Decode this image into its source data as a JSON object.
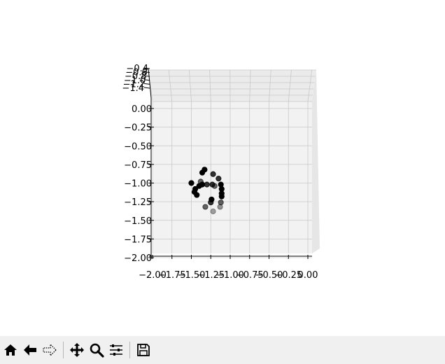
{
  "toolbar": {
    "buttons": [
      {
        "name": "home-button",
        "icon": "home-icon"
      },
      {
        "name": "back-button",
        "icon": "arrow-left-icon"
      },
      {
        "name": "forward-button",
        "icon": "arrow-right-icon"
      },
      {
        "name": "pan-button",
        "icon": "move-icon"
      },
      {
        "name": "zoom-button",
        "icon": "magnifier-icon"
      },
      {
        "name": "configure-subplots-button",
        "icon": "sliders-icon"
      },
      {
        "name": "save-button",
        "icon": "floppy-disk-icon"
      }
    ]
  },
  "chart_data": {
    "type": "scatter",
    "projection": "3d",
    "title": "",
    "xlabel": "",
    "ylabel": "",
    "zlabel": "",
    "xlim": [
      -2.0,
      0.0
    ],
    "zlim": [
      -2.0,
      0.0
    ],
    "ylim": [
      -1.4,
      -0.4
    ],
    "x_ticks": [
      "−2.00",
      "−1.75",
      "−1.50",
      "−1.25",
      "−1.00",
      "−0.75",
      "−0.50",
      "−0.25",
      "0.00"
    ],
    "z_ticks": [
      "0.00",
      "−0.25",
      "−0.50",
      "−0.75",
      "−1.00",
      "−1.25",
      "−1.50",
      "−1.75",
      "−2.00"
    ],
    "y_ticks": [
      "−0.4",
      "−0.6",
      "−0.8",
      "−1.0",
      "−1.2",
      "−1.4"
    ],
    "grid": true,
    "marker_color": "#000000",
    "pane_color": "#f2f2f2",
    "grid_color": "#c8c8c8",
    "points": [
      {
        "x": -1.33,
        "z": -0.82,
        "depth": 1.0
      },
      {
        "x": -1.36,
        "z": -0.86,
        "depth": 1.0
      },
      {
        "x": -1.22,
        "z": -0.88,
        "depth": 0.8
      },
      {
        "x": -1.15,
        "z": -0.94,
        "depth": 0.8
      },
      {
        "x": -1.38,
        "z": -0.98,
        "depth": 0.6
      },
      {
        "x": -1.5,
        "z": -1.0,
        "depth": 1.0
      },
      {
        "x": -1.36,
        "z": -1.02,
        "depth": 1.0
      },
      {
        "x": -1.3,
        "z": -1.02,
        "depth": 0.8
      },
      {
        "x": -1.23,
        "z": -1.02,
        "depth": 0.8
      },
      {
        "x": -1.4,
        "z": -1.04,
        "depth": 1.0
      },
      {
        "x": -1.2,
        "z": -1.04,
        "depth": 0.6
      },
      {
        "x": -1.12,
        "z": -1.02,
        "depth": 1.0
      },
      {
        "x": -1.45,
        "z": -1.08,
        "depth": 1.0
      },
      {
        "x": -1.11,
        "z": -1.08,
        "depth": 1.0
      },
      {
        "x": -1.46,
        "z": -1.12,
        "depth": 1.0
      },
      {
        "x": -1.11,
        "z": -1.14,
        "depth": 1.0
      },
      {
        "x": -1.43,
        "z": -1.16,
        "depth": 1.0
      },
      {
        "x": -1.11,
        "z": -1.18,
        "depth": 1.0
      },
      {
        "x": -1.24,
        "z": -1.22,
        "depth": 1.0
      },
      {
        "x": -1.25,
        "z": -1.26,
        "depth": 0.8
      },
      {
        "x": -1.12,
        "z": -1.26,
        "depth": 0.6
      },
      {
        "x": -1.32,
        "z": -1.32,
        "depth": 0.6
      },
      {
        "x": -1.13,
        "z": -1.32,
        "depth": 0.4
      },
      {
        "x": -1.22,
        "z": -1.38,
        "depth": 0.35
      }
    ]
  }
}
